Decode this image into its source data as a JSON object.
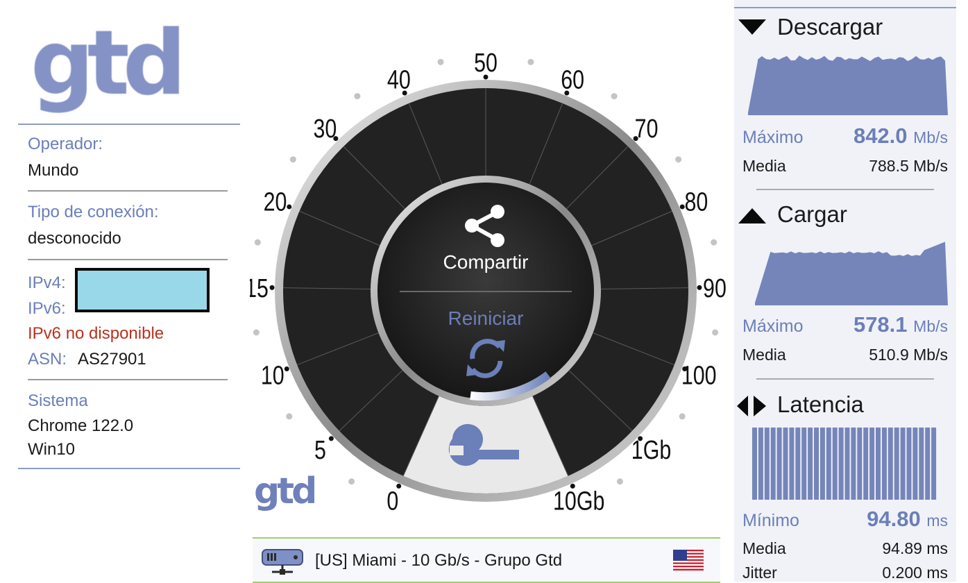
{
  "logo": {
    "text": "gtd"
  },
  "info": {
    "operator_label": "Operador:",
    "operator_value": "Mundo",
    "connection_label": "Tipo de conexión:",
    "connection_value": "desconocido",
    "ipv4_label": "IPv4:",
    "ipv6_label": "IPv6:",
    "ipv6_warning": "IPv6 no disponible",
    "asn_label": "ASN:",
    "asn_value": "AS27901",
    "system_label": "Sistema",
    "browser_value": "Chrome 122.0",
    "os_value": "Win10"
  },
  "gauge": {
    "scale_labels": [
      "0",
      "5",
      "10",
      "15",
      "20",
      "30",
      "40",
      "50",
      "60",
      "70",
      "80",
      "90",
      "100",
      "1Gb",
      "10Gb"
    ],
    "share_label": "Compartir",
    "restart_label": "Reiniciar",
    "logo_small": "gtd",
    "ring_color": "#222222",
    "accent_color": "#6b7fb8"
  },
  "server": {
    "text": "[US] Miami - 10 Gb/s - Grupo Gtd",
    "icon": "server-icon",
    "flag": "us-flag-icon"
  },
  "download": {
    "title": "Descargar",
    "max_label": "Máximo",
    "max_value": "842.0",
    "max_unit": "Mb/s",
    "avg_label": "Media",
    "avg_value": "788.5 Mb/s"
  },
  "upload": {
    "title": "Cargar",
    "max_label": "Máximo",
    "max_value": "578.1",
    "max_unit": "Mb/s",
    "avg_label": "Media",
    "avg_value": "510.9 Mb/s"
  },
  "latency": {
    "title": "Latencia",
    "min_label": "Mínimo",
    "min_value": "94.80",
    "min_unit": "ms",
    "avg_label": "Media",
    "avg_value": "94.89 ms",
    "jitter_label": "Jitter",
    "jitter_value": "0.200 ms"
  },
  "colors": {
    "accent": "#6b7fb8",
    "graph_fill": "#7585ba",
    "warning": "#b8321e",
    "ip_mask": "#99d8e9"
  }
}
